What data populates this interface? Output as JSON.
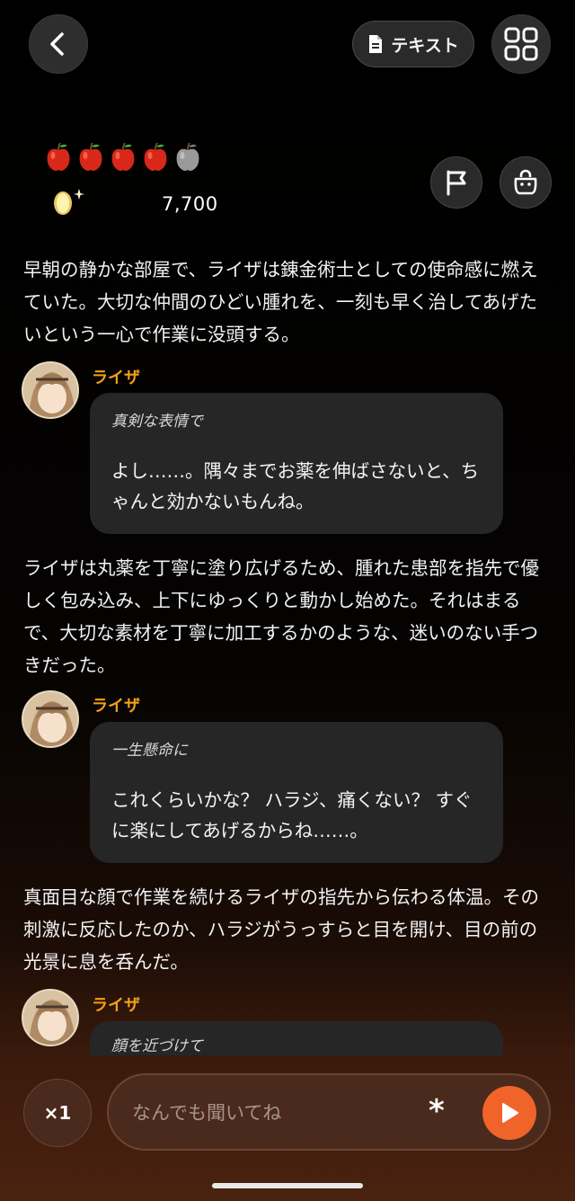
{
  "header": {
    "text_button_label": "テキスト"
  },
  "status": {
    "apples_total": 5,
    "apples_filled": 4,
    "coins": "7,700"
  },
  "story": [
    {
      "type": "narration",
      "text": "早朝の静かな部屋で、ライザは錬金術士としての使命感に燃えていた。大切な仲間のひどい腫れを、一刻も早く治してあげたいという一心で作業に没頭する。"
    },
    {
      "type": "dialogue",
      "speaker": "ライザ",
      "direction": "真剣な表情で",
      "line": "よし……。隅々までお薬を伸ばさないと、ちゃんと効かないもんね。"
    },
    {
      "type": "narration",
      "text": "ライザは丸薬を丁寧に塗り広げるため、腫れた患部を指先で優しく包み込み、上下にゆっくりと動かし始めた。それはまるで、大切な素材を丁寧に加工するかのような、迷いのない手つきだった。"
    },
    {
      "type": "dialogue",
      "speaker": "ライザ",
      "direction": "一生懸命に",
      "line": "これくらいかな？ ハラジ、痛くない？ すぐに楽にしてあげるからね……。"
    },
    {
      "type": "narration",
      "text": "真面目な顔で作業を続けるライザの指先から伝わる体温。その刺激に反応したのか、ハラジがうっすらと目を開け、目の前の光景に息を呑んだ。"
    },
    {
      "type": "dialogue",
      "speaker": "ライザ",
      "direction": "顔を近づけて",
      "line": ""
    }
  ],
  "composer": {
    "speed_label": "×1",
    "placeholder": "なんでも聞いてね",
    "asterisk": "*"
  },
  "colors": {
    "accent": "#f0642a",
    "speaker": "#f0a018",
    "bubble": "#262626"
  },
  "icons": [
    "chevron-left-icon",
    "document-icon",
    "grid-icon",
    "apple-icon",
    "coin-icon",
    "flag-icon",
    "bag-icon",
    "play-icon"
  ]
}
